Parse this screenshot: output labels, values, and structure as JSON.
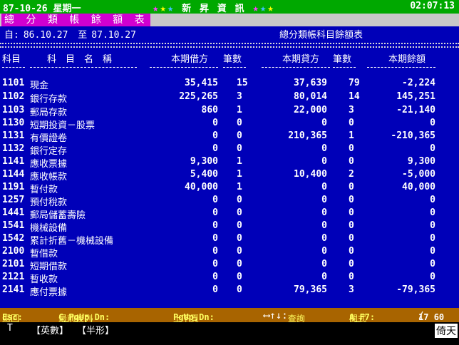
{
  "topbar": {
    "date": "87-10-26 星期一",
    "app_title": "新 昇 資 訊",
    "time": "02:07:13"
  },
  "report": {
    "title": "總 分 類 帳 餘 額 表",
    "period": {
      "from_label": "自:",
      "from": "86.10.27",
      "to_label": "至",
      "to": "87.10.27"
    },
    "subtitle": "總分類帳科目餘額表"
  },
  "columns": {
    "code": "科目",
    "name": "科　目　名　稱",
    "debit": "本期借方",
    "debit_count": "筆數",
    "credit": "本期貸方",
    "credit_count": "筆數",
    "balance": "本期餘額"
  },
  "rows": [
    {
      "code": "1101",
      "name": "現金",
      "debit": "35,415",
      "debit_count": "15",
      "credit": "37,639",
      "credit_count": "79",
      "balance": "-2,224"
    },
    {
      "code": "1102",
      "name": "銀行存款",
      "debit": "225,265",
      "debit_count": "3",
      "credit": "80,014",
      "credit_count": "14",
      "balance": "145,251"
    },
    {
      "code": "1103",
      "name": "郵局存款",
      "debit": "860",
      "debit_count": "1",
      "credit": "22,000",
      "credit_count": "3",
      "balance": "-21,140"
    },
    {
      "code": "1130",
      "name": "短期投資－股票",
      "debit": "0",
      "debit_count": "0",
      "credit": "0",
      "credit_count": "0",
      "balance": "0"
    },
    {
      "code": "1131",
      "name": "有價證卷",
      "debit": "0",
      "debit_count": "0",
      "credit": "210,365",
      "credit_count": "1",
      "balance": "-210,365"
    },
    {
      "code": "1132",
      "name": "銀行定存",
      "debit": "0",
      "debit_count": "0",
      "credit": "0",
      "credit_count": "0",
      "balance": "0"
    },
    {
      "code": "1141",
      "name": "應收票據",
      "debit": "9,300",
      "debit_count": "1",
      "credit": "0",
      "credit_count": "0",
      "balance": "9,300"
    },
    {
      "code": "1144",
      "name": "應收帳款",
      "debit": "5,400",
      "debit_count": "1",
      "credit": "10,400",
      "credit_count": "2",
      "balance": "-5,000"
    },
    {
      "code": "1191",
      "name": "暫付款",
      "debit": "40,000",
      "debit_count": "1",
      "credit": "0",
      "credit_count": "0",
      "balance": "40,000"
    },
    {
      "code": "1257",
      "name": "預付稅款",
      "debit": "0",
      "debit_count": "0",
      "credit": "0",
      "credit_count": "0",
      "balance": "0"
    },
    {
      "code": "1441",
      "name": "郵局儲蓄壽險",
      "debit": "0",
      "debit_count": "0",
      "credit": "0",
      "credit_count": "0",
      "balance": "0"
    },
    {
      "code": "1541",
      "name": "機械設備",
      "debit": "0",
      "debit_count": "0",
      "credit": "0",
      "credit_count": "0",
      "balance": "0"
    },
    {
      "code": "1542",
      "name": "累計折舊－機械設備",
      "debit": "0",
      "debit_count": "0",
      "credit": "0",
      "credit_count": "0",
      "balance": "0"
    },
    {
      "code": "2100",
      "name": "暫借款",
      "debit": "0",
      "debit_count": "0",
      "credit": "0",
      "credit_count": "0",
      "balance": "0"
    },
    {
      "code": "2101",
      "name": "短期借款",
      "debit": "0",
      "debit_count": "0",
      "credit": "0",
      "credit_count": "0",
      "balance": "0"
    },
    {
      "code": "2121",
      "name": "暫收款",
      "debit": "0",
      "debit_count": "0",
      "credit": "0",
      "credit_count": "0",
      "balance": "0"
    },
    {
      "code": "2141",
      "name": "應付票據",
      "debit": "0",
      "debit_count": "0",
      "credit": "79,365",
      "credit_count": "3",
      "balance": "-79,365"
    }
  ],
  "statusbar": {
    "esc_key": "Esc:",
    "esc_label": "返回",
    "page_key": "C_PgUp,Dn:",
    "page_label": "最前後列",
    "scroll_key": "PgUp,Dn:",
    "scroll_label": "上下頁",
    "arrows": "⟷↑↓:",
    "arrows_label": "查詢",
    "print_key": "A_F7:",
    "print_label": "閱式",
    "page_current": "17",
    "page_total": "60"
  },
  "ime": {
    "mode": "T",
    "char_mode": "【英數】",
    "width_mode": "【半形】",
    "ime_name": "倚天"
  },
  "colors": {
    "background": "#0000b8",
    "topbar": "#00a800",
    "title_bg": "#d000d0",
    "status_bg": "#a86400"
  }
}
